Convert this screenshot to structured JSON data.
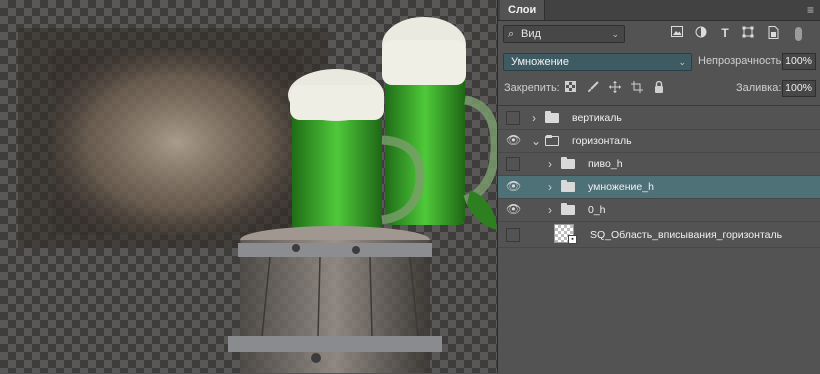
{
  "panel": {
    "tab_label": "Слои",
    "filter": {
      "value": "Вид",
      "search_glyph": "⌕",
      "chevron": "⌄"
    },
    "filter_icons": [
      "image-filter-icon",
      "adjustment-filter-icon",
      "type-filter-icon",
      "shape-filter-icon",
      "smart-object-filter-icon"
    ],
    "blend_mode": "Умножение",
    "opacity_label": "Непрозрачность:",
    "opacity_value": "100%",
    "lock_label": "Закрепить:",
    "fill_label": "Заливка:",
    "fill_value": "100%"
  },
  "layers": [
    {
      "name": "вертикаль",
      "visible": false,
      "type": "group",
      "expanded": false,
      "indent": 0,
      "selected": false
    },
    {
      "name": "горизонталь",
      "visible": true,
      "type": "group",
      "expanded": true,
      "indent": 0,
      "selected": false
    },
    {
      "name": "пиво_h",
      "visible": false,
      "type": "group",
      "expanded": false,
      "indent": 1,
      "selected": false
    },
    {
      "name": "умножение_h",
      "visible": true,
      "type": "group",
      "expanded": false,
      "indent": 1,
      "selected": true
    },
    {
      "name": "0_h",
      "visible": true,
      "type": "group",
      "expanded": false,
      "indent": 1,
      "selected": false
    },
    {
      "name": "SQ_Область_вписывания_горизонталь",
      "visible": false,
      "type": "smart",
      "expanded": false,
      "indent": 0,
      "selected": false
    }
  ],
  "colors": {
    "selected_layer": "#4e7077",
    "blend_bg": "#3e5b63",
    "beer": "#3fae2c"
  }
}
